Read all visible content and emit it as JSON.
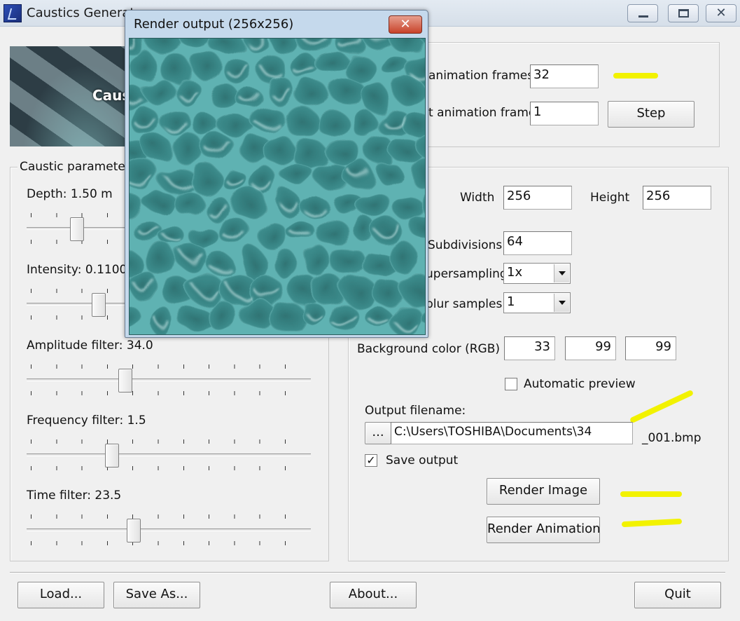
{
  "window": {
    "title": "Caustics Generator",
    "controls": [
      "minimize",
      "maximize",
      "close"
    ]
  },
  "preview": {
    "caption": "Caus"
  },
  "animation": {
    "frames_label": "animation frames",
    "frames_value": "32",
    "current_label": "t animation frame",
    "current_value": "1",
    "step_label": "Step"
  },
  "caustic": {
    "group_label": "Caustic parameters",
    "depth_label": "Depth:  1.50 m",
    "depth_level": 0.16,
    "intensity_label": "Intensity: 0.1100",
    "intensity_level": 0.24,
    "amplitude_label": "Amplitude filter:  34.0",
    "amplitude_level": 0.34,
    "frequency_label": "Frequency filter:   1.5",
    "frequency_level": 0.29,
    "time_label": "Time filter:     23.5",
    "time_level": 0.37
  },
  "render": {
    "width_label": "Width",
    "width_value": "256",
    "height_label": "Height",
    "height_value": "256",
    "subdivisions_label": "Subdivisions",
    "subdivisions_value": "64",
    "supersampling_label": "upersampling",
    "supersampling_value": "1x",
    "blur_label": "blur samples",
    "blur_value": "1",
    "bg_label": "Background color (RGB)",
    "bg_r": "33",
    "bg_g": "99",
    "bg_b": "99",
    "auto_preview_label": "Automatic preview",
    "auto_preview_checked": false,
    "output_label": "Output filename:",
    "browse_label": "...",
    "output_path": "C:\\Users\\TOSHIBA\\Documents\\34",
    "output_suffix": "_001.bmp",
    "save_output_label": "Save output",
    "save_output_checked": true,
    "render_image_label": "Render Image",
    "render_animation_label": "Render Animation"
  },
  "bottom": {
    "load_label": "Load...",
    "save_as_label": "Save As...",
    "about_label": "About...",
    "quit_label": "Quit"
  },
  "render_window": {
    "title": "Render output (256x256)",
    "close_glyph": "✕"
  },
  "colors": {
    "water": "#3d8a8a",
    "highlight_marker": "#f2f200"
  }
}
